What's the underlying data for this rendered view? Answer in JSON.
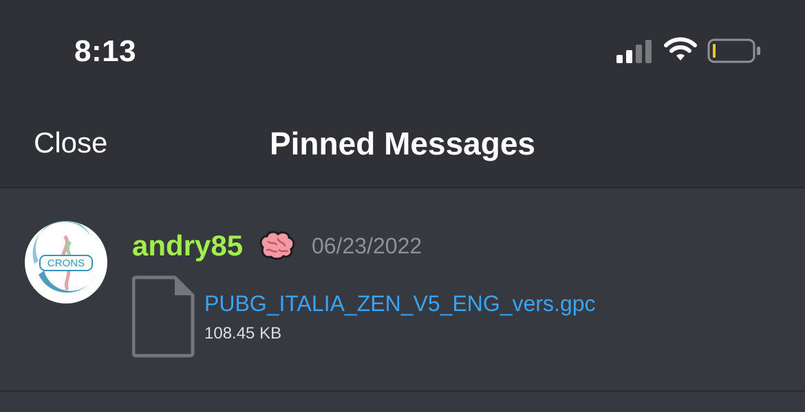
{
  "status_bar": {
    "time": "8:13",
    "icons": [
      "cellular-signal-icon",
      "wifi-icon",
      "battery-icon"
    ]
  },
  "header": {
    "close_label": "Close",
    "title": "Pinned Messages"
  },
  "messages": [
    {
      "username": "andry85",
      "username_color": "#a0ef4a",
      "badge_icon": "brain-icon",
      "timestamp": "06/23/2022",
      "avatar_text": "CRONS",
      "attachment": {
        "icon": "file-icon",
        "name": "PUBG_ITALIA_ZEN_V5_ENG_vers.gpc",
        "size": "108.45 KB",
        "link_color": "#3aa3f5"
      }
    }
  ],
  "colors": {
    "background": "#36393f",
    "header_background": "#2f3136",
    "text": "#ffffff",
    "muted": "#8e9297"
  }
}
